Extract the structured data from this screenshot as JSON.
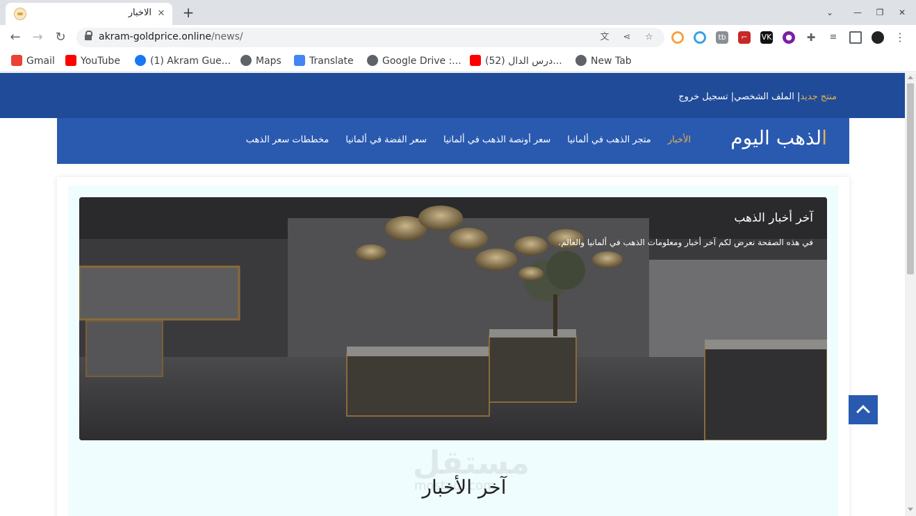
{
  "browser": {
    "tab_title": "الاخبار",
    "tab_close": "✕",
    "new_tab": "+",
    "url_host": "akram-goldprice.online",
    "url_path": "/news/",
    "bookmarks": [
      {
        "label": "Gmail",
        "icon": "gmail-icon",
        "color": "#ea4335"
      },
      {
        "label": "YouTube",
        "icon": "youtube-icon",
        "color": "#ff0000"
      },
      {
        "label": "(1) Akram Gue...",
        "icon": "facebook-icon",
        "color": "#1877f2"
      },
      {
        "label": "Maps",
        "icon": "globe-icon",
        "color": "#5f6368"
      },
      {
        "label": "Translate",
        "icon": "translate-icon",
        "color": "#4285f4"
      },
      {
        "label": "Google Drive :...",
        "icon": "globe-icon",
        "color": "#5f6368"
      },
      {
        "label": "(52) درس الدال...",
        "icon": "youtube-icon",
        "color": "#ff0000"
      },
      {
        "label": "New Tab",
        "icon": "globe-icon",
        "color": "#5f6368"
      }
    ]
  },
  "site": {
    "user_links": {
      "new_product": "منتج جديد",
      "separator1": "|",
      "profile": " الملف الشخصي",
      "separator2": "|",
      "logout": " تسجيل خروج"
    },
    "brand_first": "ا",
    "brand_rest": "لذهب اليوم",
    "nav": [
      {
        "label": "الأخبار",
        "active": true
      },
      {
        "label": "متجر الذهب في ألمانيا",
        "active": false
      },
      {
        "label": "سعر أونصة الذهب في ألمانيا",
        "active": false
      },
      {
        "label": "سعر الفضة في ألمانيا",
        "active": false
      },
      {
        "label": "مخططات سعر الذهب",
        "active": false
      }
    ],
    "hero": {
      "title": "آخر أخبار الذهب",
      "text": "في هذه الصفحة نعرض لكم آخر أخبار ومعلومات الذهب في ألمانيا والعالم."
    },
    "watermark_big": "مستقل",
    "watermark_small": "mostaql.com",
    "section_title": "آخر الأخبار"
  },
  "colors": {
    "topbar": "#1f4b99",
    "nav": "#2a5ab0",
    "accent_gold": "#e8b24a",
    "panel_bg": "#f0fdff"
  }
}
